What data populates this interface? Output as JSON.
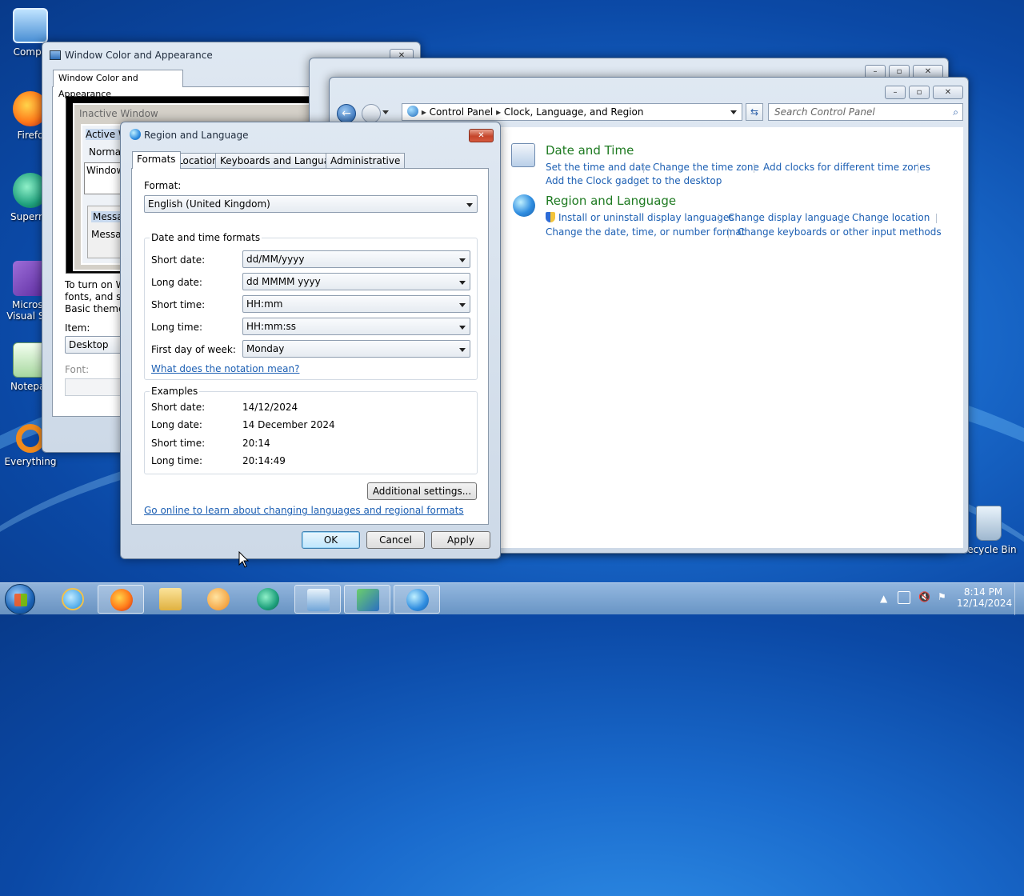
{
  "desktop": {
    "icons": [
      {
        "label": "Compu"
      },
      {
        "label": "Firefo"
      },
      {
        "label": "Supermi"
      },
      {
        "label": "Microso"
      },
      {
        "label": "Visual Stu"
      },
      {
        "label": "Notepac"
      },
      {
        "label": "Everything"
      },
      {
        "label": "Recycle Bin"
      }
    ]
  },
  "wca": {
    "title": "Window Color and Appearance",
    "tab": "Window Color and Appearance",
    "preview": {
      "inactive": "Inactive Window",
      "active": "Active W",
      "normal": "Norma",
      "window": "Window",
      "message1": "Messa",
      "message2": "Messa"
    },
    "desc1": "To turn on W",
    "desc2": "fonts, and siz",
    "desc3": "Basic theme o",
    "item_label": "Item:",
    "item_value": "Desktop",
    "font_label": "Font:"
  },
  "cp": {
    "breadcrumb": [
      "Control Panel",
      "Clock, Language, and Region"
    ],
    "search_placeholder": "Search Control Panel",
    "datetime": {
      "title": "Date and Time",
      "links": [
        "Set the time and date",
        "Change the time zone",
        "Add clocks for different time zones",
        "Add the Clock gadget to the desktop"
      ]
    },
    "region": {
      "title": "Region and Language",
      "links": [
        "Install or uninstall display languages",
        "Change display language",
        "Change location",
        "Change the date, time, or number format",
        "Change keyboards or other input methods"
      ]
    }
  },
  "dialog": {
    "title": "Region and Language",
    "tabs": [
      "Formats",
      "Location",
      "Keyboards and Languages",
      "Administrative"
    ],
    "format_label": "Format:",
    "format_value": "English (United Kingdom)",
    "dt_group": "Date and time formats",
    "rows": [
      {
        "label": "Short date:",
        "value": "dd/MM/yyyy"
      },
      {
        "label": "Long date:",
        "value": "dd MMMM yyyy"
      },
      {
        "label": "Short time:",
        "value": "HH:mm"
      },
      {
        "label": "Long time:",
        "value": "HH:mm:ss"
      },
      {
        "label": "First day of week:",
        "value": "Monday"
      }
    ],
    "notation_link": "What does the notation mean?",
    "examples_group": "Examples",
    "examples": [
      {
        "label": "Short date:",
        "value": "14/12/2024"
      },
      {
        "label": "Long date:",
        "value": "14 December 2024"
      },
      {
        "label": "Short time:",
        "value": "20:14"
      },
      {
        "label": "Long time:",
        "value": "20:14:49"
      }
    ],
    "additional_button": "Additional settings...",
    "online_link": "Go online to learn about changing languages and regional formats",
    "ok": "OK",
    "cancel": "Cancel",
    "apply": "Apply"
  },
  "taskbar": {
    "time": "8:14 PM",
    "date": "12/14/2024"
  }
}
